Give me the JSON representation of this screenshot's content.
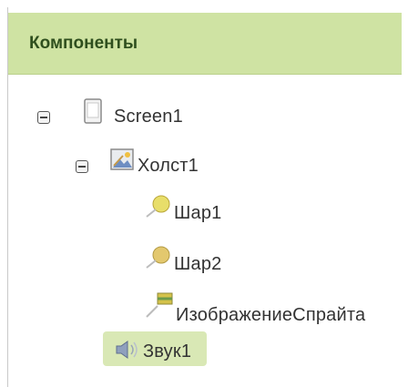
{
  "panel": {
    "title": "Компоненты"
  },
  "tree": {
    "screen": {
      "label": "Screen1",
      "toggle_icon": "minus-square-icon",
      "icon": "screen-icon"
    },
    "canvas": {
      "label": "Холст1",
      "toggle_icon": "minus-square-icon",
      "icon": "canvas-icon"
    },
    "ball1": {
      "label": "Шар1",
      "icon": "ball-icon"
    },
    "ball2": {
      "label": "Шар2",
      "icon": "ball-icon"
    },
    "sprite": {
      "label": "ИзображениеСпрайта",
      "icon": "image-sprite-icon"
    },
    "sound": {
      "label": "Звук1",
      "icon": "speaker-icon",
      "selected": true
    }
  },
  "colors": {
    "header_bg": "#cfe3a3",
    "selection_bg": "#d9e8b5"
  }
}
